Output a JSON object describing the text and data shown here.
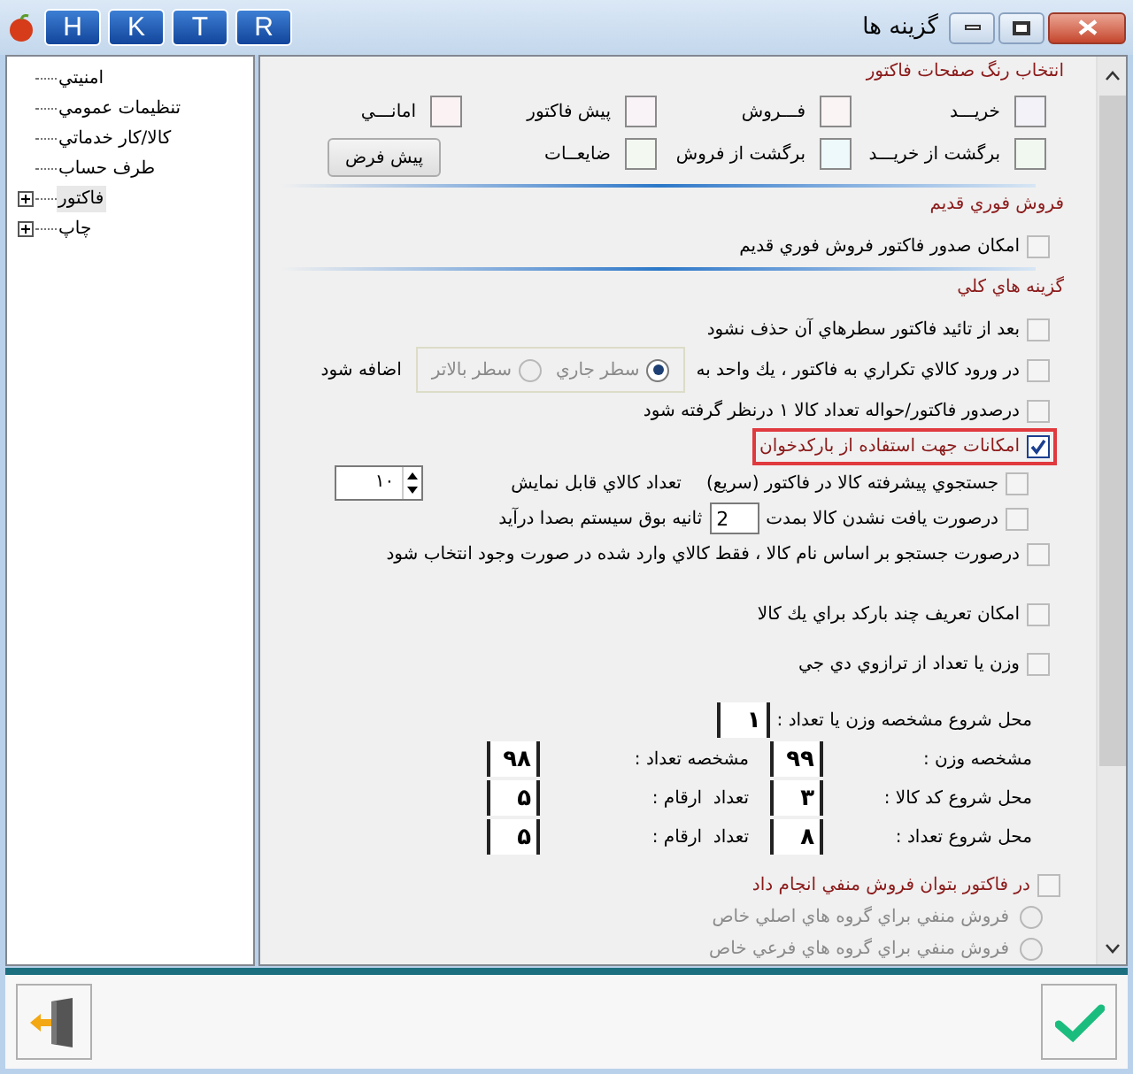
{
  "window": {
    "title": "گزينه ها",
    "toolbar_buttons": [
      "R",
      "T",
      "K",
      "H"
    ]
  },
  "tree": [
    {
      "label": "امنيتي",
      "expandable": false,
      "selected": false
    },
    {
      "label": "تنظيمات عمومي",
      "expandable": false,
      "selected": false
    },
    {
      "label": "كالا/كار خدماتي",
      "expandable": false,
      "selected": false
    },
    {
      "label": "طرف حساب",
      "expandable": false,
      "selected": false
    },
    {
      "label": "فاكتور",
      "expandable": true,
      "selected": true
    },
    {
      "label": "چاپ",
      "expandable": true,
      "selected": false
    }
  ],
  "color_section": {
    "heading": "انتخاب رنگ صفحات فاكتور",
    "swatches": [
      {
        "label": "خريـــد",
        "color": "#f3f2f8"
      },
      {
        "label": "فـــروش",
        "color": "#faf4f4"
      },
      {
        "label": "پيش فاكتور",
        "color": "#f9f3f8"
      },
      {
        "label": "امانـــي",
        "color": "#faf2f3"
      },
      {
        "label": "برگشت از خريـــد",
        "color": "#f1f8f0"
      },
      {
        "label": "برگشت از فروش",
        "color": "#edf9fb"
      },
      {
        "label": "ضايعــات",
        "color": "#f3f8f1"
      }
    ],
    "default_button": "پيش فرض"
  },
  "quick_sale": {
    "heading": "فروش فوري قديم",
    "option": {
      "label": "امكان صدور فاكتور فروش فوري قديم",
      "checked": false
    }
  },
  "general": {
    "heading": "گزينه هاي كلي",
    "options": [
      {
        "kind": "check",
        "label": "بعد از تائيد فاكتور سطرهاي آن حذف نشود",
        "checked": false,
        "highlighted": false
      },
      {
        "kind": "radio",
        "label": "در ورود كالاي تكراري به فاكتور ، يك واحد به",
        "checked": false,
        "highlighted": false,
        "choices": [
          {
            "label": "سطر جاري",
            "selected": true
          },
          {
            "label": "سطر بالاتر",
            "selected": false
          }
        ],
        "suffix": "اضافه شود"
      },
      {
        "kind": "check",
        "label": "درصدور فاكتور/حواله تعداد كالا ۱ درنظر گرفته شود",
        "checked": false,
        "highlighted": false
      },
      {
        "kind": "check",
        "label": "امكانات جهت استفاده از باركدخوان",
        "checked": true,
        "highlighted": true
      },
      {
        "kind": "spinner",
        "label": "جستجوي پيشرفته كالا در فاكتور (سريع)",
        "checked": false,
        "highlighted": false,
        "suffix": "تعداد كالاي قابل نمايش",
        "value": "۱۰"
      },
      {
        "kind": "input",
        "label": "درصورت يافت نشدن كالا بمدت",
        "checked": false,
        "highlighted": false,
        "value": "2",
        "suffix": "ثانيه بوق سيستم بصدا درآيد"
      },
      {
        "kind": "check",
        "label": "درصورت جستجو بر اساس نام كالا ، فقط كالاي وارد شده در صورت وجود انتخاب شود",
        "checked": false,
        "highlighted": false
      }
    ],
    "more_options": [
      {
        "label": "امكان تعريف چند باركد براي يك كالا",
        "checked": false
      },
      {
        "label": "وزن يا تعداد از ترازوي دي جي",
        "checked": false
      }
    ],
    "scale_fields": [
      [
        {
          "label": "محل شروع مشخصه وزن يا تعداد :",
          "value": "۱"
        }
      ],
      [
        {
          "label": "مشخصه وزن :",
          "value": "۹۹"
        },
        {
          "label": "مشخصه تعداد :",
          "value": "۹۸"
        }
      ],
      [
        {
          "label": "محل شروع كد كالا :",
          "value": "۳"
        },
        {
          "label": "تعداد  ارقام :",
          "value": "۵"
        }
      ],
      [
        {
          "label": "محل شروع تعداد :",
          "value": "۸"
        },
        {
          "label": "تعداد  ارقام :",
          "value": "۵"
        }
      ]
    ],
    "negative_sale": {
      "label": "در فاكتور بتوان فروش منفي انجام داد",
      "checked": false,
      "choices": [
        {
          "label": "فروش منفي براي گروه هاي اصلي خاص",
          "selected": false
        },
        {
          "label": "فروش منفي براي گروه هاي فرعي خاص",
          "selected": false
        }
      ]
    }
  }
}
